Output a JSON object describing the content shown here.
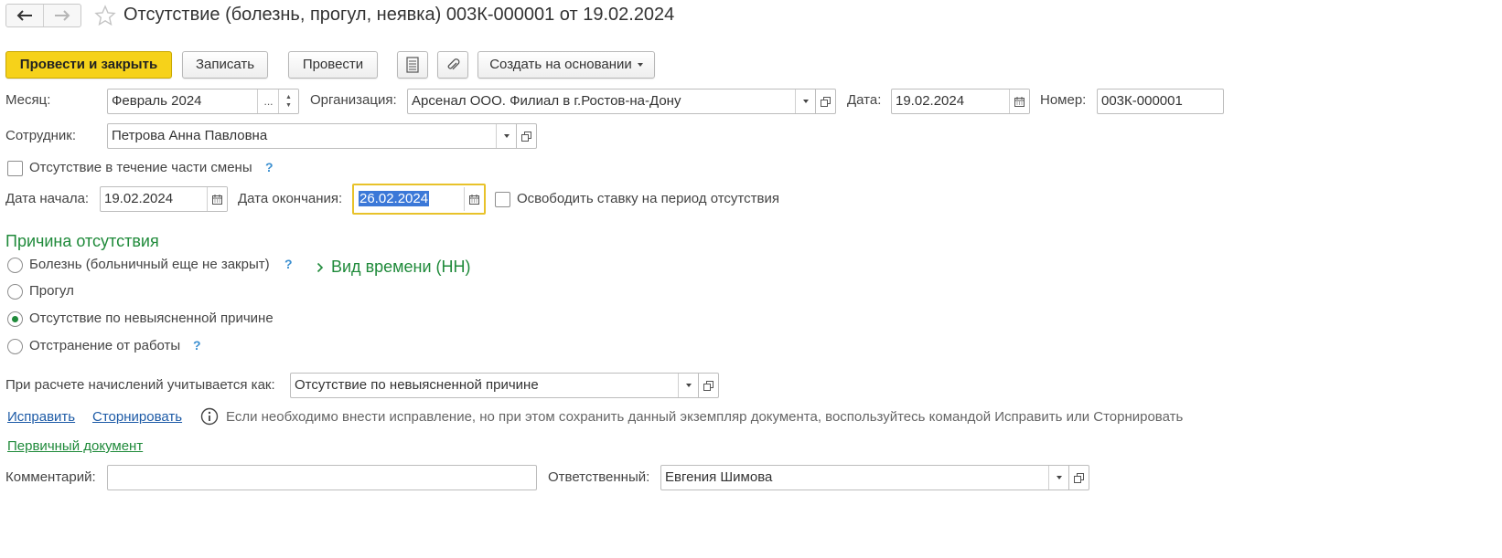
{
  "header": {
    "title": "Отсутствие (болезнь, прогул, неявка) 003К-000001 от 19.02.2024"
  },
  "toolbar": {
    "post_close": "Провести и закрыть",
    "save": "Записать",
    "post": "Провести",
    "create_based": "Создать на основании"
  },
  "form": {
    "month_label": "Месяц:",
    "month_value": "Февраль 2024",
    "month_dots": "...",
    "org_label": "Организация:",
    "org_value": "Арсенал ООО. Филиал в г.Ростов-на-Дону",
    "date_label": "Дата:",
    "date_value": "19.02.2024",
    "number_label": "Номер:",
    "number_value": "003К-000001",
    "employee_label": "Сотрудник:",
    "employee_value": "Петрова Анна Павловна",
    "partial_shift_label": "Отсутствие в течение части смены",
    "start_label": "Дата начала:",
    "start_value": "19.02.2024",
    "end_label": "Дата окончания:",
    "end_value": "26.02.2024",
    "free_rate_label": "Освободить ставку на период отсутствия",
    "help_mark": "?"
  },
  "reason": {
    "heading": "Причина отсутствия",
    "options": [
      "Болезнь (больничный еще не закрыт)",
      "Прогул",
      "Отсутствие по невыясненной причине",
      "Отстранение от работы"
    ],
    "selected_index": 2,
    "time_kind": "Вид времени (НН)"
  },
  "accrual": {
    "label": "При расчете начислений учитывается как:",
    "value": "Отсутствие по невыясненной причине"
  },
  "actions": {
    "fix": "Исправить",
    "reverse": "Сторнировать",
    "info": "Если необходимо внести исправление, но при этом сохранить данный экземпляр документа, воспользуйтесь командой Исправить или Сторнировать",
    "primary_doc": "Первичный документ"
  },
  "footer": {
    "comment_label": "Комментарий:",
    "comment_value": "",
    "responsible_label": "Ответственный:",
    "responsible_value": "Евгения Шимова"
  }
}
